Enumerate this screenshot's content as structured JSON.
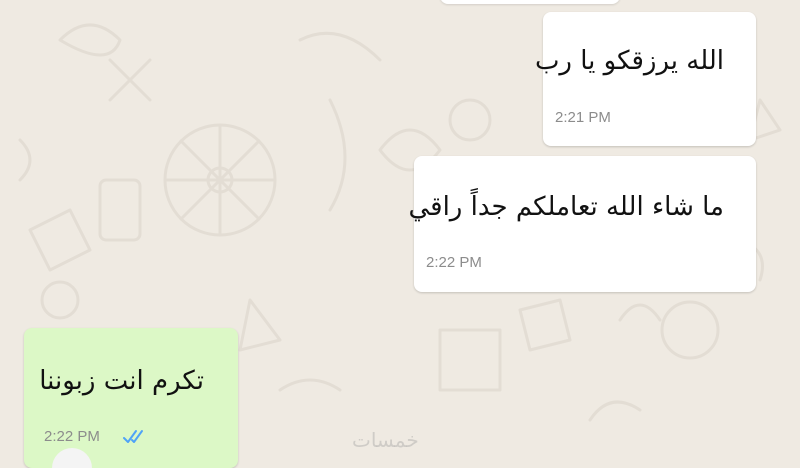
{
  "chat": {
    "messages": [
      {
        "text": "الله يرزقكو يا رب",
        "time": "2:21 PM",
        "direction": "outgoing"
      },
      {
        "text": "ما شاء الله تعاملكم جداً راقي",
        "time": "2:22 PM",
        "direction": "outgoing"
      },
      {
        "text": "تكرم انت زبوننا",
        "time": "2:22 PM",
        "direction": "incoming",
        "status": "read"
      }
    ],
    "watermark": "خمسات"
  },
  "colors": {
    "background": "#efeae2",
    "bubble_white": "#ffffff",
    "bubble_green": "#dcf8c6",
    "read_tick": "#4fa3f7",
    "time_text": "#8c8c8c"
  },
  "icons": {
    "read_status": "double-check-icon"
  }
}
